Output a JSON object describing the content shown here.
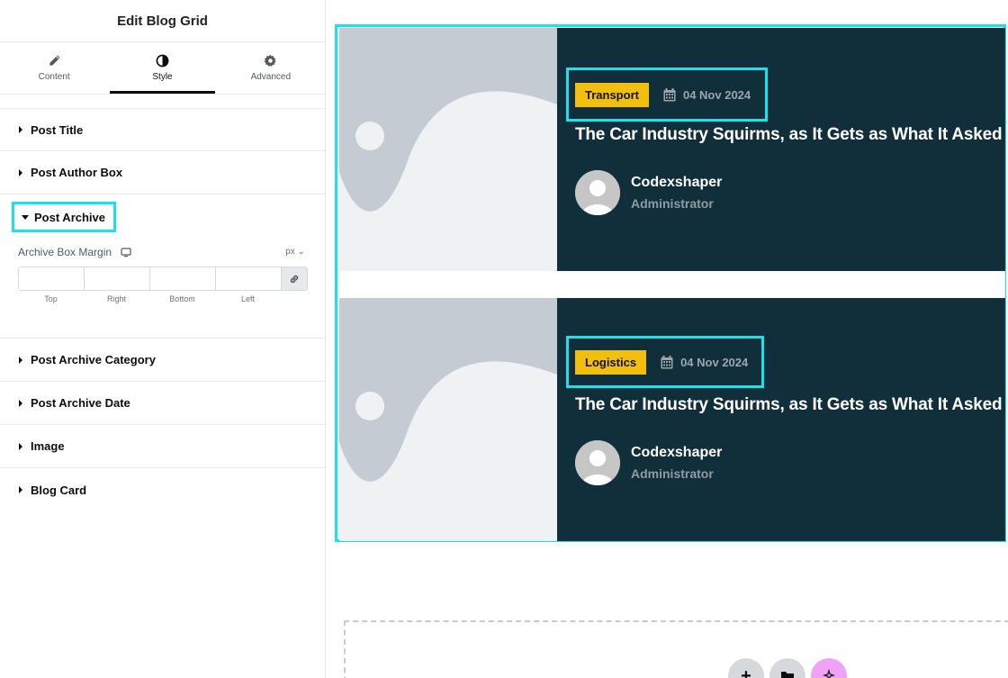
{
  "panel": {
    "title": "Edit Blog Grid",
    "tabs": [
      {
        "label": "Content",
        "icon": "pencil-icon"
      },
      {
        "label": "Style",
        "icon": "contrast-icon",
        "active": true
      },
      {
        "label": "Advanced",
        "icon": "gear-icon"
      }
    ],
    "sections": {
      "post_title": "Post Title",
      "post_author_box": "Post Author Box",
      "post_archive": "Post Archive",
      "post_archive_category": "Post Archive Category",
      "post_archive_date": "Post Archive Date",
      "image": "Image",
      "blog_card": "Blog Card"
    },
    "archive_margin": {
      "label": "Archive Box Margin",
      "unit": "px",
      "fields": [
        "Top",
        "Right",
        "Bottom",
        "Left"
      ],
      "values": [
        "",
        "",
        "",
        ""
      ]
    }
  },
  "posts": [
    {
      "category": "Transport",
      "date": "04 Nov 2024",
      "title": "The Car Industry Squirms, as It Gets as What It Asked",
      "author": "Codexshaper",
      "role": "Administrator"
    },
    {
      "category": "Logistics",
      "date": "04 Nov 2024",
      "title": "The Car Industry Squirms, as It Gets as What It Asked",
      "author": "Codexshaper",
      "role": "Administrator"
    }
  ],
  "dropzone": {
    "add_icon": "+",
    "folder_icon": "folder-icon",
    "ai_icon": "sparkle-icon"
  },
  "colors": {
    "accent_outline": "#18e2ee",
    "card_bg": "#102f3a",
    "badge": "#f2bf0d",
    "ai_button": "#f0a3f6"
  }
}
